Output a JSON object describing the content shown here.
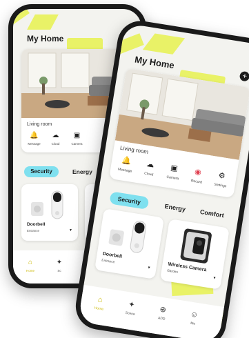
{
  "colors": {
    "accent_yellow": "#e6f14f",
    "tab_active_bg": "#7fe0ef",
    "nav_active": "#cbb800",
    "record_red": "#e04050"
  },
  "back_phone": {
    "title": "My Home",
    "add_icon": "plus-icon",
    "room": {
      "label": "Living room"
    },
    "quick_actions": [
      {
        "icon": "bell-icon",
        "label": "Message"
      },
      {
        "icon": "cloud-icon",
        "label": "Cloud"
      },
      {
        "icon": "camera-icon",
        "label": "Camera"
      }
    ],
    "tabs": {
      "active": "Security",
      "second": "Energy"
    },
    "device": {
      "name": "Doorbell",
      "room": "Entrance"
    },
    "nav": [
      {
        "icon": "home-icon",
        "label": "Home"
      },
      {
        "icon": "scene-icon",
        "label": "Sc"
      }
    ]
  },
  "front_phone": {
    "title": "My Home",
    "add_icon": "plus-icon",
    "room": {
      "label": "Living room"
    },
    "quick_actions": [
      {
        "icon": "bell-icon",
        "label": "Message"
      },
      {
        "icon": "cloud-icon",
        "label": "Cloud"
      },
      {
        "icon": "camera-icon",
        "label": "Camera"
      },
      {
        "icon": "record-icon",
        "label": "Record"
      },
      {
        "icon": "settings-icon",
        "label": "Settings"
      }
    ],
    "tabs": {
      "active": "Security",
      "second": "Energy",
      "third": "Comfort"
    },
    "devices": [
      {
        "name": "Doorbell",
        "room": "Entrance"
      },
      {
        "name": "Wireless Camera",
        "room": "Garden"
      }
    ],
    "nav": [
      {
        "icon": "home-icon",
        "label": "Home"
      },
      {
        "icon": "scene-icon",
        "label": "Scene"
      },
      {
        "icon": "add-icon",
        "label": "ADD"
      },
      {
        "icon": "user-icon",
        "label": "Me"
      }
    ]
  }
}
